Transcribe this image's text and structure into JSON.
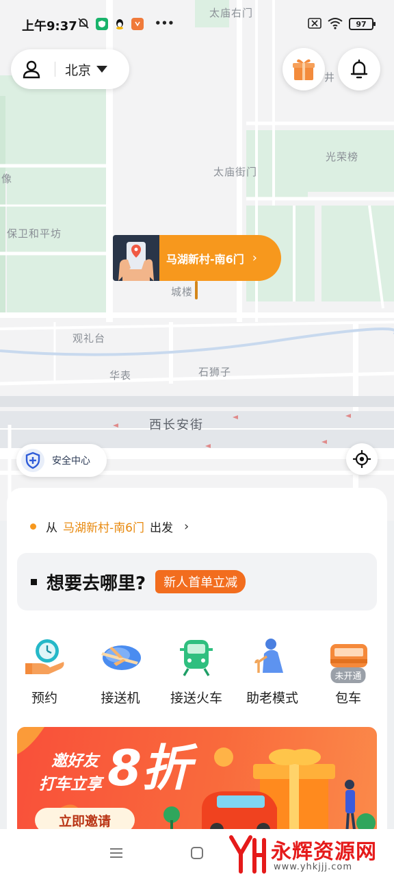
{
  "status_bar": {
    "time": "上午9:37",
    "more": "•••",
    "battery": "97"
  },
  "map": {
    "labels": [
      "太庙右门",
      "光荣榜",
      "太庙街门",
      "山像",
      "保卫和平坊",
      "城楼",
      "观礼台",
      "华表",
      "石狮子",
      "井"
    ],
    "street": "西长安街"
  },
  "header": {
    "city": "北京"
  },
  "pickup": {
    "name": "马湖新村-南6门",
    "chevron": "›"
  },
  "safety": {
    "label": "安全中心"
  },
  "sheet": {
    "from_prefix": "从",
    "from_place": "马湖新村-南6门",
    "from_suffix": "出发",
    "chevron": "›",
    "destination_prompt": "想要去哪里?",
    "promo": "新人首单立减"
  },
  "services": [
    {
      "label": "预约",
      "icon": "reserve-clock-icon"
    },
    {
      "label": "接送机",
      "icon": "airplane-icon"
    },
    {
      "label": "接送火车",
      "icon": "train-icon"
    },
    {
      "label": "助老模式",
      "icon": "elderly-icon"
    },
    {
      "label": "包车",
      "icon": "charter-bus-icon",
      "badge": "未开通"
    }
  ],
  "banner": {
    "line1": "邀好友",
    "line2": "打车立享",
    "discount": "8折",
    "cta": "立即邀请"
  },
  "watermark": {
    "title": "永辉资源网",
    "url": "www.yhkjjj.com"
  },
  "colors": {
    "accent": "#f7981d",
    "promo": "#f26d1e",
    "banner": "#f9503a",
    "map_green": "#dff0e5"
  }
}
